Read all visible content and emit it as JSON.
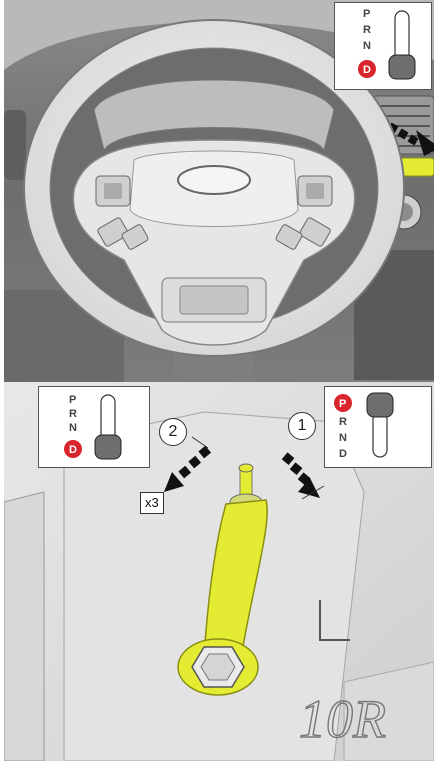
{
  "top_inset": {
    "gears": [
      "P",
      "R",
      "N",
      "D"
    ],
    "active_gear": "D"
  },
  "bottom_left_inset": {
    "gears": [
      "P",
      "R",
      "N",
      "D"
    ],
    "active_gear": "D"
  },
  "bottom_right_inset": {
    "gears": [
      "P",
      "R",
      "N",
      "D"
    ],
    "active_gear": "P"
  },
  "steps": {
    "step_1": "1",
    "step_2": "2",
    "multiplier": "x3"
  },
  "casting_mark": "10R",
  "colors": {
    "highlight": "#e3ec33",
    "active_gear": "#d8262c",
    "background_gray": "#c9c9c9"
  }
}
